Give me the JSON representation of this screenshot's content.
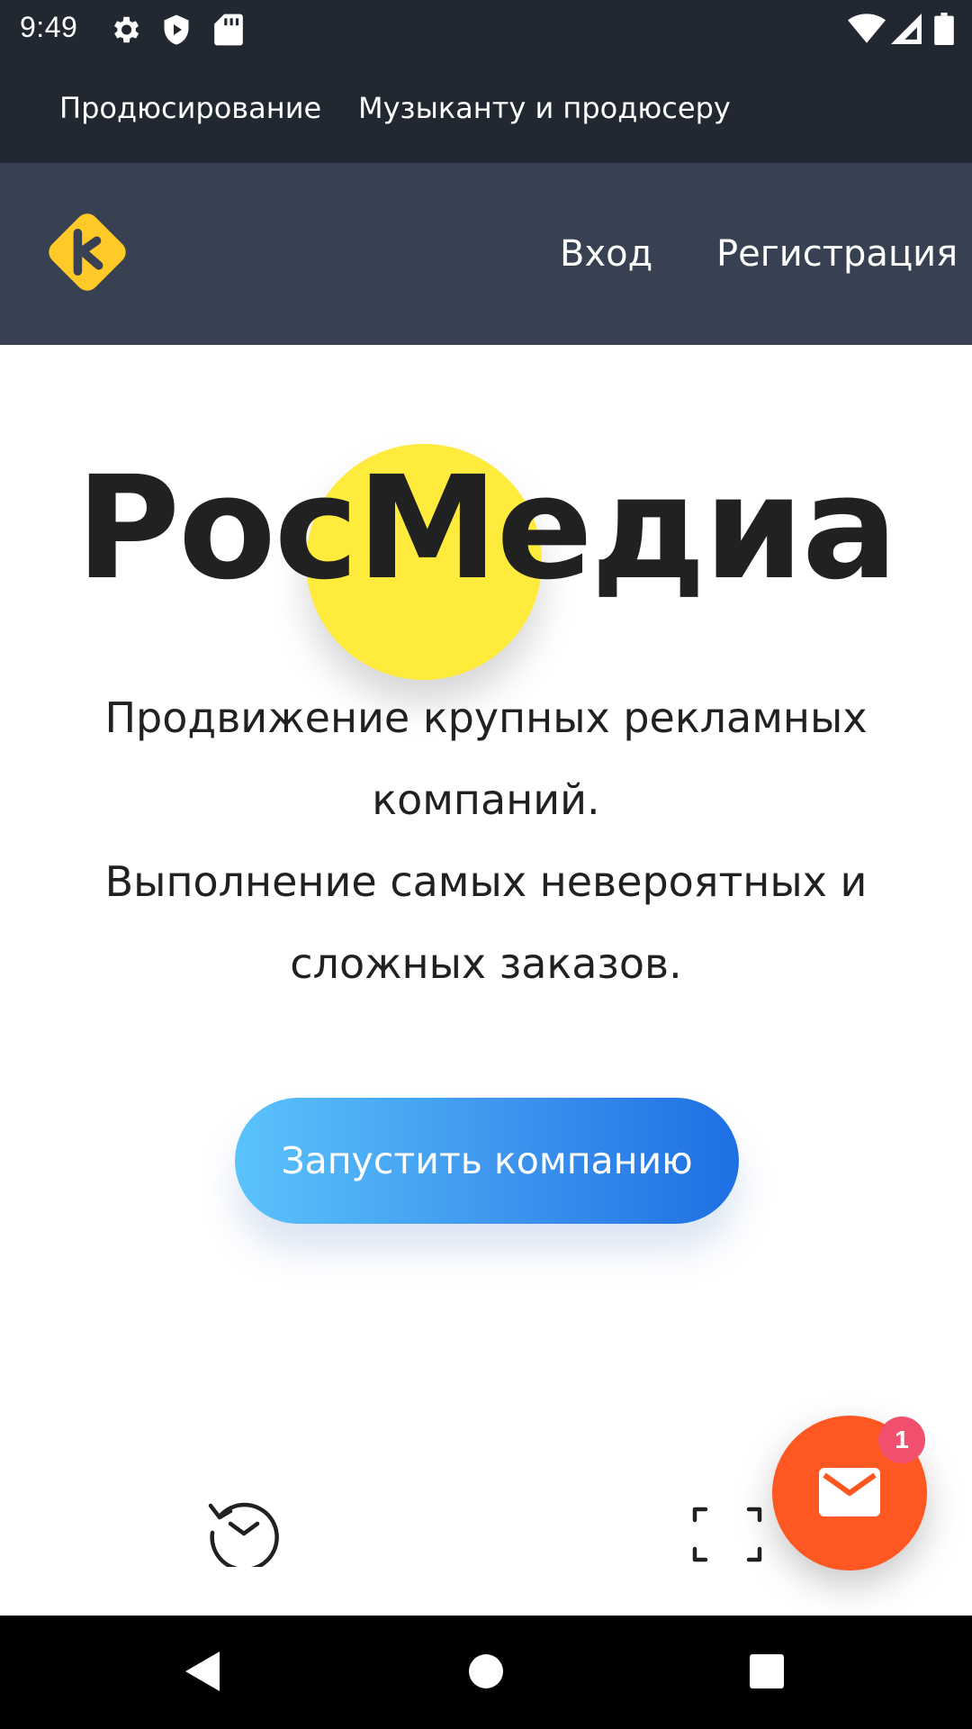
{
  "status_bar": {
    "time": "9:49",
    "icons": [
      "settings-icon",
      "shield-play-icon",
      "sd-card-icon",
      "wifi-icon",
      "cellular-signal-icon",
      "battery-icon"
    ]
  },
  "top_nav": {
    "links": [
      "Продюсирование",
      "Музыканту и продюсеру"
    ]
  },
  "header": {
    "logo_icon": "brand-logo-icon",
    "login_label": "Вход",
    "register_label": "Регистрация"
  },
  "hero": {
    "title": "РосМедиа",
    "lines": [
      "Продвижение крупных рекламных",
      "компаний.",
      "Выполнение самых невероятных и",
      "сложных заказов."
    ],
    "cta_label": "Запустить компанию"
  },
  "page_icons": [
    "history-icon",
    "scan-icon"
  ],
  "fab": {
    "icon": "mail-icon",
    "badge_count": "1"
  },
  "android_nav": {
    "icons": [
      "back-icon",
      "home-icon",
      "recents-icon"
    ]
  },
  "colors": {
    "status_bg": "#222831",
    "header_bg": "#374151",
    "accent_yellow": "#ffeb3b",
    "fab_orange": "#ff5722",
    "badge_pink": "#f0506e",
    "cta_gradient_start": "#5ac3fb",
    "cta_gradient_end": "#1e6fe3"
  }
}
